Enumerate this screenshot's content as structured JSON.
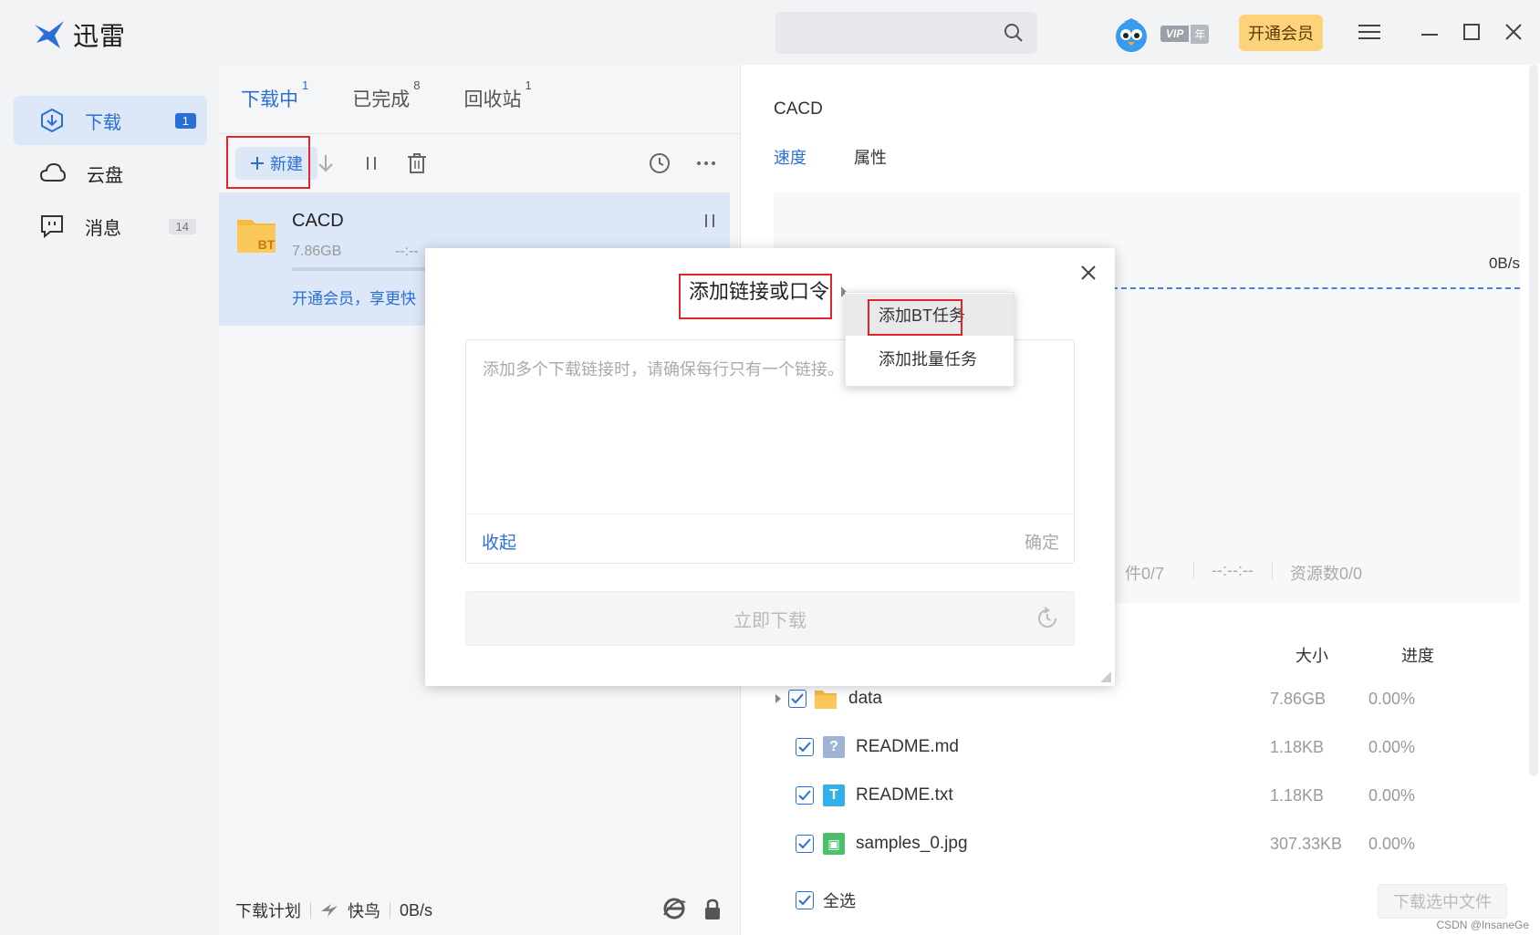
{
  "app": {
    "name": "迅雷",
    "brand_color": "#2a6fd6",
    "accent_color": "#e0262b"
  },
  "header": {
    "search_placeholder": "",
    "vip_label": "VIP",
    "vip_year": "年",
    "open_vip_label": "开通会员"
  },
  "sidebar": {
    "items": [
      {
        "label": "下载",
        "count": "1",
        "icon": "download-icon",
        "active": true
      },
      {
        "label": "云盘",
        "count": "",
        "icon": "cloud-icon",
        "active": false
      },
      {
        "label": "消息",
        "count": "14",
        "icon": "message-icon",
        "active": false
      }
    ]
  },
  "list": {
    "tabs": [
      {
        "label": "下载中",
        "count": "1"
      },
      {
        "label": "已完成",
        "count": "8"
      },
      {
        "label": "回收站",
        "count": "1"
      }
    ],
    "new_label": "新建",
    "task": {
      "name": "CACD",
      "size": "7.86GB",
      "eta": "--:--",
      "promo": "开通会员，享更快",
      "type_badge": "BT"
    },
    "status": {
      "plan": "下载计划",
      "mode": "快鸟",
      "speed": "0B/s"
    }
  },
  "detail": {
    "title": "CACD",
    "tabs": [
      "速度",
      "属性"
    ],
    "speed_value": "0B/s",
    "stats": {
      "files": "件0/7",
      "time": "--:--:--",
      "sources": "资源数0/0"
    },
    "columns": {
      "size": "大小",
      "progress": "进度"
    },
    "files": [
      {
        "name": "data",
        "size": "7.86GB",
        "progress": "0.00%",
        "icon": "folder-icon",
        "color": "#f8b940"
      },
      {
        "name": "README.md",
        "size": "1.18KB",
        "progress": "0.00%",
        "icon": "unknown-file-icon",
        "color": "#9eb4d4",
        "glyph": "?"
      },
      {
        "name": "README.txt",
        "size": "1.18KB",
        "progress": "0.00%",
        "icon": "text-file-icon",
        "color": "#34b0e8",
        "glyph": "T"
      },
      {
        "name": "samples_0.jpg",
        "size": "307.33KB",
        "progress": "0.00%",
        "icon": "image-file-icon",
        "color": "#4cbf6b",
        "glyph": "▣"
      }
    ],
    "select_all": "全选",
    "download_selected": "下载选中文件",
    "watermark": "CSDN @InsaneGe"
  },
  "dialog": {
    "title": "添加链接或口令",
    "placeholder": "添加多个下载链接时，请确保每行只有一个链接。",
    "collapse": "收起",
    "confirm": "确定",
    "download_now": "立即下载"
  },
  "menu": {
    "items": [
      "添加BT任务",
      "添加批量任务"
    ]
  }
}
